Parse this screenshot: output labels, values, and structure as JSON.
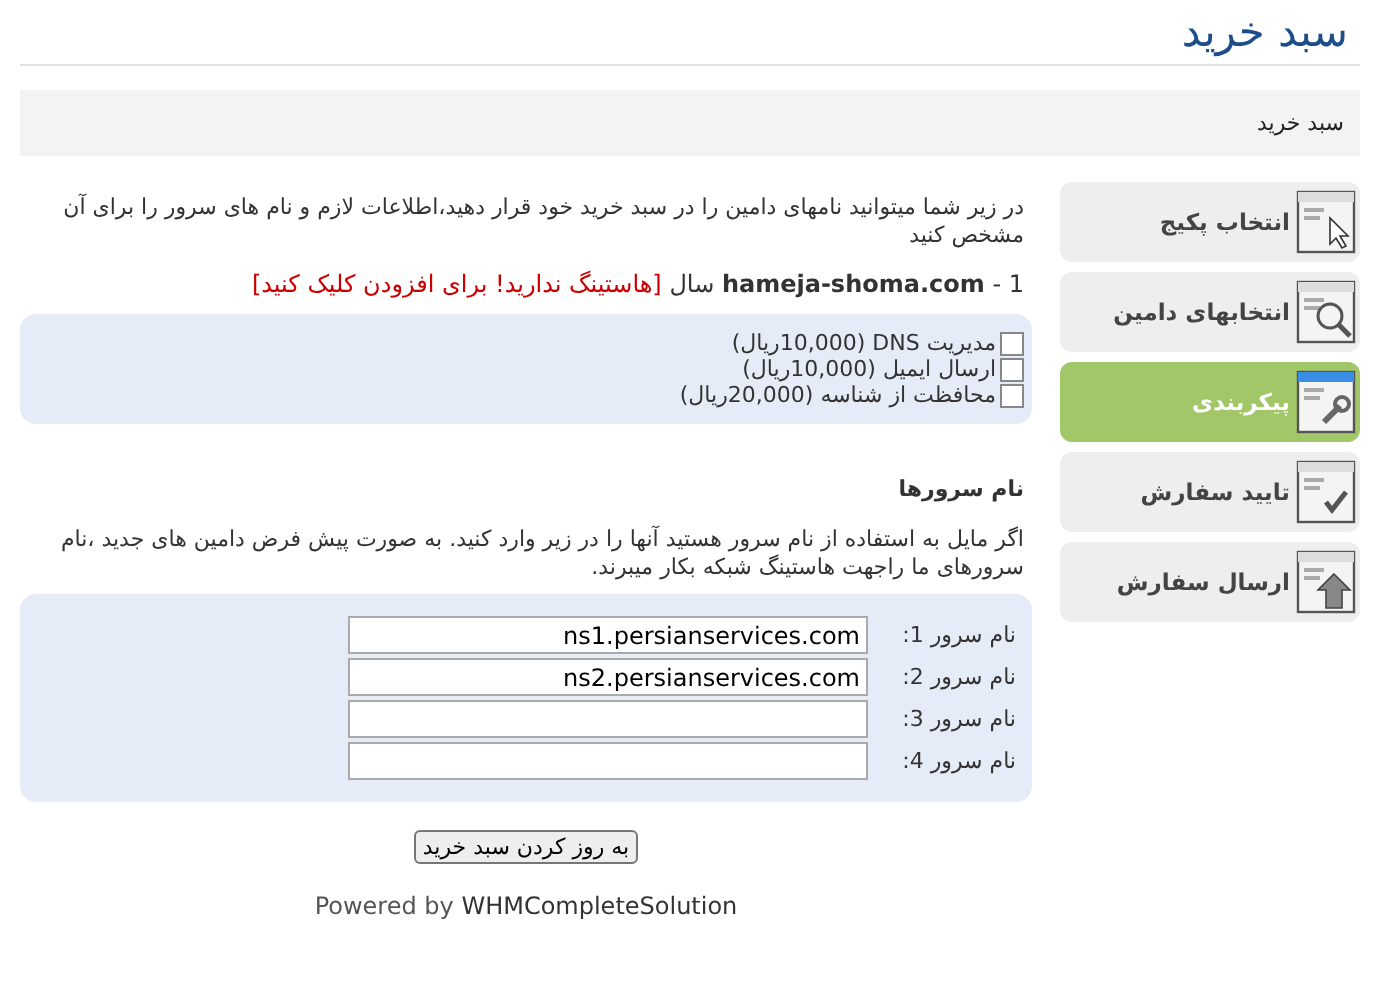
{
  "page_title": "سبد خرید",
  "breadcrumb": "سبد خرید",
  "steps": [
    {
      "label": "انتخاب پکیج",
      "kind": "package",
      "selected": false
    },
    {
      "label": "انتخابهای دامین",
      "kind": "domain",
      "selected": false
    },
    {
      "label": "پیکربندی",
      "kind": "configure",
      "selected": true
    },
    {
      "label": "تایید سفارش",
      "kind": "confirm",
      "selected": false
    },
    {
      "label": "ارسال سفارش",
      "kind": "submit",
      "selected": false
    }
  ],
  "intro": "در زیر شما میتوانید نامهای دامین را در سبد خرید خود قرار دهید،اطلاعات لازم و نام های سرور را برای آن مشخص کنید",
  "domain_line": {
    "text": "1 - **hameja-shoma.com** سال",
    "link": "[هاستینگ ندارید! برای افزودن کلیک کنید]"
  },
  "addons": [
    {
      "label": "مدیریت DNS (10,000ریال)",
      "checked": false
    },
    {
      "label": "ارسال ایمیل (10,000ریال)",
      "checked": false
    },
    {
      "label": "محافظت از شناسه (20,000ریال)",
      "checked": false
    }
  ],
  "nameservers_heading": "نام سرورها",
  "nameservers_note": "اگر مایل به استفاده از نام سرور هستید آنها را در زیر وارد کنید. به صورت پیش فرض دامین های جدید ،نام سرورهای ما راجهت هاستینگ شبکه بکار میبرند.",
  "nameservers": [
    {
      "label": "نام سرور 1:",
      "value": "ns1.persianservices.com"
    },
    {
      "label": "نام سرور 2:",
      "value": "ns2.persianservices.com"
    },
    {
      "label": "نام سرور 3:"
    },
    {
      "label": "نام سرور 4:"
    }
  ],
  "update_button": "به روز کردن سبد خرید",
  "footer": {
    "text": "Powered by",
    "link": "WHMCompleteSolution"
  }
}
